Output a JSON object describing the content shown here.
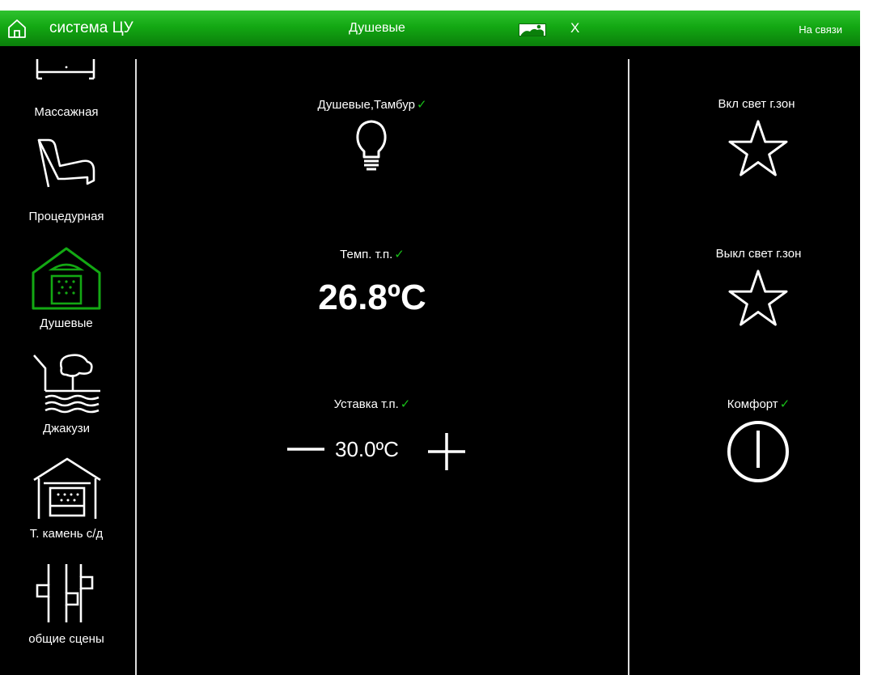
{
  "header": {
    "home_icon": "home-icon",
    "app_title": "система ЦУ",
    "room_title": "Душевые",
    "weather_icon": "weather-cloud-sun-icon",
    "close_label": "X",
    "status": "На связи",
    "accent_color": "#13a813"
  },
  "sidebar": {
    "items": [
      {
        "label": "Массажная",
        "icon": "massage-table-icon",
        "active": false
      },
      {
        "label": "Процедурная",
        "icon": "chair-icon",
        "active": false
      },
      {
        "label": "Душевые",
        "icon": "shower-house-icon",
        "active": true
      },
      {
        "label": "Джакузи",
        "icon": "jacuzzi-icon",
        "active": false
      },
      {
        "label": "Т. камень с/д",
        "icon": "sauna-stone-icon",
        "active": false
      },
      {
        "label": "общие сцены",
        "icon": "sliders-icon",
        "active": false
      }
    ]
  },
  "main": {
    "light": {
      "label": "Душевые,Тамбур",
      "check": "✓",
      "icon": "lightbulb-icon"
    },
    "temperature": {
      "label": "Темп. т.п.",
      "check": "✓",
      "value": "26.8ºC"
    },
    "setpoint": {
      "label": "Уставка т.п.",
      "check": "✓",
      "value": "30.0ºC",
      "minus_icon": "minus-icon",
      "plus_icon": "plus-icon"
    }
  },
  "scenes": {
    "light_on": {
      "label": "Вкл свет г.зон",
      "icon": "star-icon"
    },
    "light_off": {
      "label": "Выкл свет г.зон",
      "icon": "star-icon"
    },
    "comfort": {
      "label": "Комфорт",
      "check": "✓",
      "icon": "power-icon"
    }
  },
  "colors": {
    "check": "#19c019",
    "active_icon": "#13a813"
  }
}
